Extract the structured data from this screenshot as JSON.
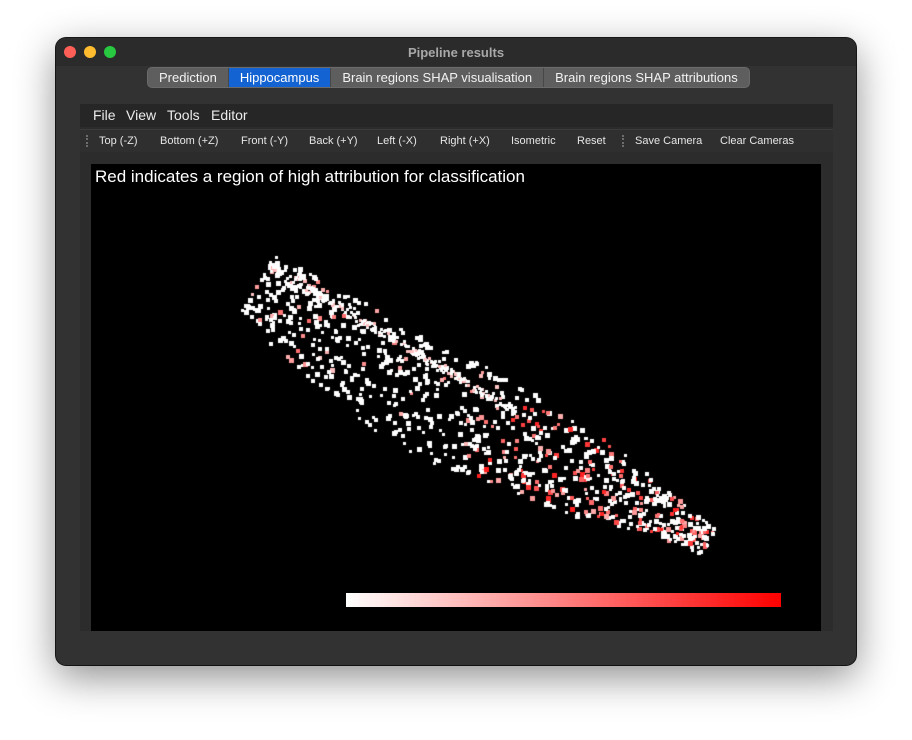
{
  "window": {
    "title": "Pipeline results"
  },
  "tabs": [
    {
      "label": "Prediction",
      "active": false
    },
    {
      "label": "Hippocampus",
      "active": true
    },
    {
      "label": "Brain regions SHAP visualisation",
      "active": false
    },
    {
      "label": "Brain regions SHAP attributions",
      "active": false
    }
  ],
  "menu": {
    "file": "File",
    "view": "View",
    "tools": "Tools",
    "editor": "Editor"
  },
  "toolbar": {
    "top": "Top (-Z)",
    "bottom": "Bottom (+Z)",
    "front": "Front (-Y)",
    "back": "Back (+Y)",
    "left": "Left (-X)",
    "right": "Right (+X)",
    "isometric": "Isometric",
    "reset": "Reset",
    "save_camera": "Save Camera",
    "clear_cameras": "Clear Cameras"
  },
  "viewport": {
    "caption": "Red indicates a region of high attribution for classification",
    "colors": {
      "background": "#000000",
      "low": "#ffffff",
      "high": "#ff0000"
    }
  },
  "colors": {
    "accent": "#1463d2",
    "window_bg": "#323232"
  }
}
